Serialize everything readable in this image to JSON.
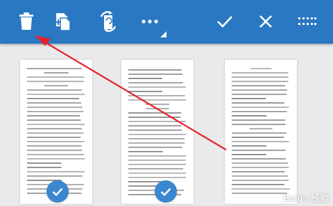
{
  "toolbar": {
    "background": "#2a78c2",
    "buttons": [
      {
        "name": "delete",
        "icon": "trash-icon"
      },
      {
        "name": "extract",
        "icon": "extract-pages-icon"
      },
      {
        "name": "rotate",
        "icon": "rotate-icon"
      },
      {
        "name": "more",
        "icon": "more-dots-icon"
      },
      {
        "name": "confirm",
        "icon": "check-icon"
      },
      {
        "name": "close",
        "icon": "close-icon"
      },
      {
        "name": "view",
        "icon": "grid-icon"
      }
    ]
  },
  "pages": [
    {
      "id": 1,
      "selected": true
    },
    {
      "id": 2,
      "selected": true
    },
    {
      "id": 3,
      "selected": false
    }
  ],
  "annotation": {
    "color": "#e8202a",
    "type": "arrow"
  },
  "watermark": {
    "text": "Baidu 经验"
  }
}
